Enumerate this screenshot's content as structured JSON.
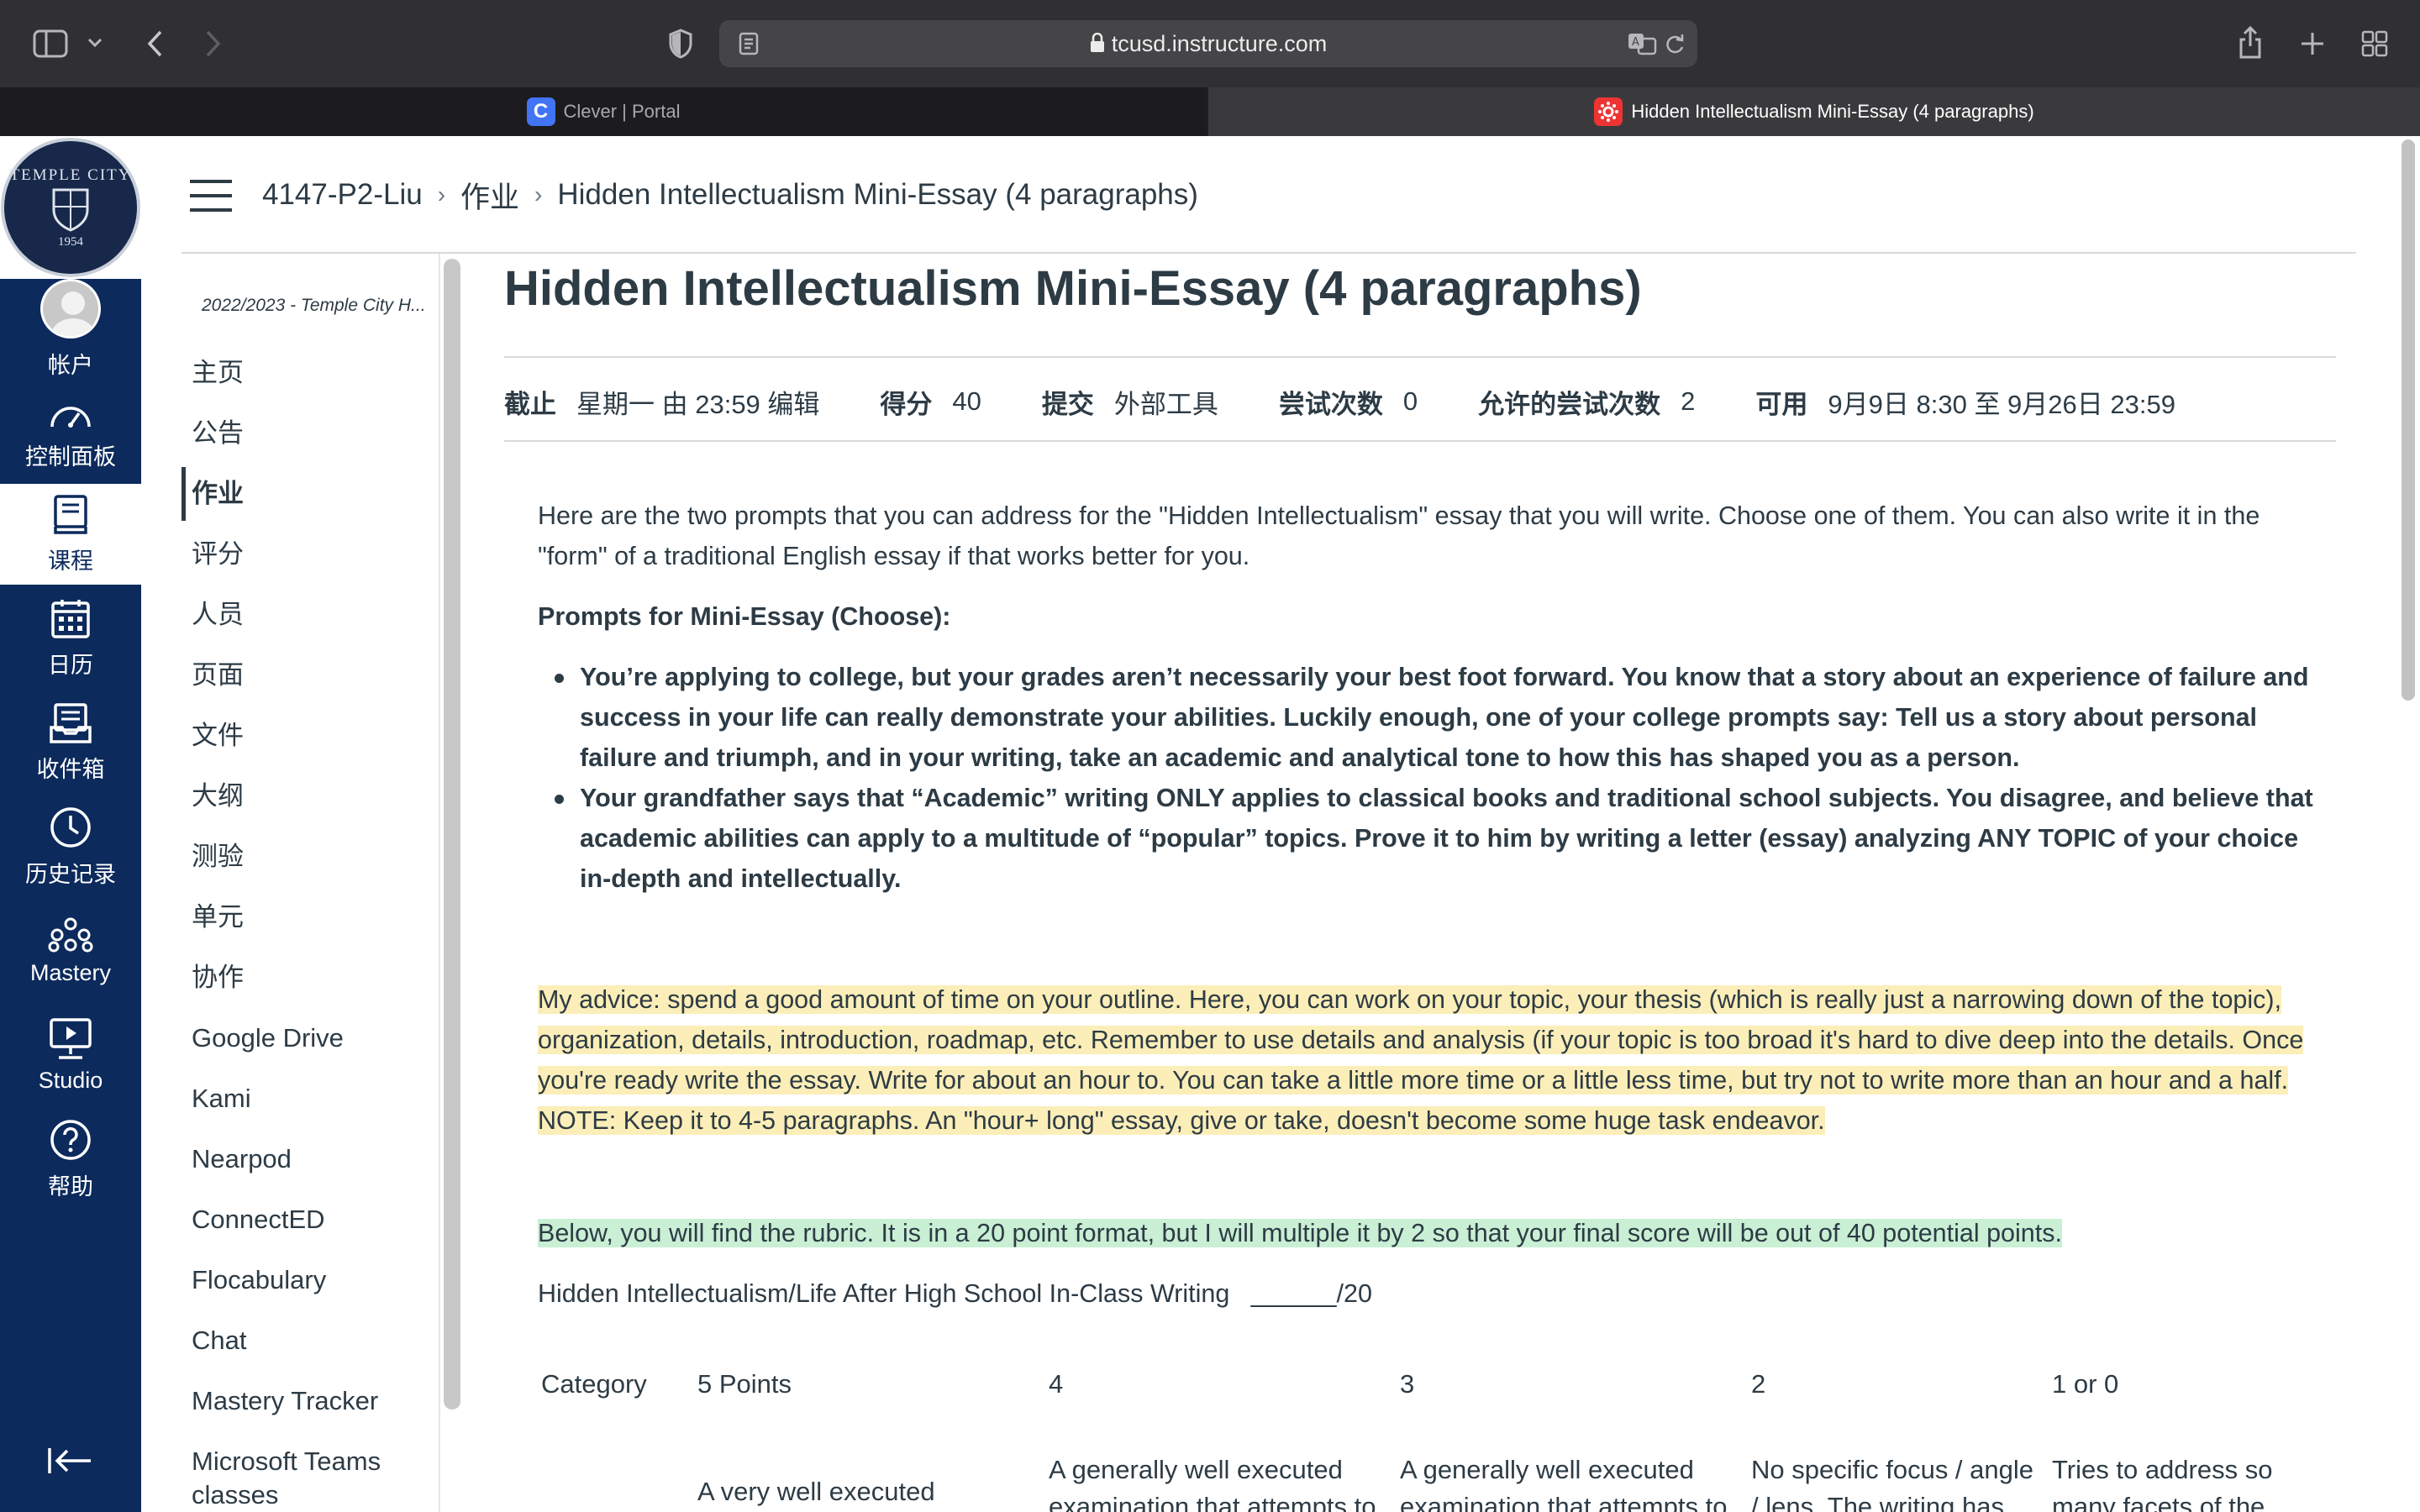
{
  "browser": {
    "url": "tcusd.instructure.com",
    "tabs": [
      {
        "label": "Clever | Portal",
        "icon": "C"
      },
      {
        "label": "Hidden Intellectualism Mini-Essay (4 paragraphs)"
      }
    ]
  },
  "global_nav": {
    "logo": {
      "text": "TEMPLE CITY",
      "year": "1954"
    },
    "items": [
      {
        "label": "帐户",
        "icon": "account-icon"
      },
      {
        "label": "控制面板",
        "icon": "dashboard-icon"
      },
      {
        "label": "课程",
        "icon": "courses-icon"
      },
      {
        "label": "日历",
        "icon": "calendar-icon"
      },
      {
        "label": "收件箱",
        "icon": "inbox-icon"
      },
      {
        "label": "历史记录",
        "icon": "history-icon"
      },
      {
        "label": "Mastery",
        "icon": "mastery-icon"
      },
      {
        "label": "Studio",
        "icon": "studio-icon"
      },
      {
        "label": "帮助",
        "icon": "help-icon"
      }
    ]
  },
  "breadcrumb": {
    "course": "4147-P2-Liu",
    "section": "作业",
    "page": "Hidden Intellectualism Mini-Essay (4 paragraphs)"
  },
  "course_nav": {
    "term": "2022/2023 - Temple City H...",
    "items": [
      "主页",
      "公告",
      "作业",
      "评分",
      "人员",
      "页面",
      "文件",
      "大纲",
      "测验",
      "单元",
      "协作",
      "Google Drive",
      "Kami",
      "Nearpod",
      "ConnectED",
      "Flocabulary",
      "Chat",
      "Mastery Tracker",
      "Microsoft Teams classes"
    ],
    "active": "作业"
  },
  "assignment": {
    "title": "Hidden Intellectualism Mini-Essay (4 paragraphs)",
    "details": {
      "due_label": "截止",
      "due_value": "星期一 由 23:59 编辑",
      "points_label": "得分",
      "points_value": "40",
      "submit_label": "提交",
      "submit_value": "外部工具",
      "attempts_label": "尝试次数",
      "attempts_value": "0",
      "allowed_label": "允许的尝试次数",
      "allowed_value": "2",
      "available_label": "可用",
      "available_value": "9月9日 8:30 至 9月26日 23:59"
    },
    "intro": "Here are the two prompts that you can address for the \"Hidden Intellectualism\" essay that you will write. Choose one of them. You can also write it in the \"form\" of a traditional English essay if that works better for you.",
    "prompts_heading": "Prompts for Mini-Essay (Choose):",
    "prompts": [
      "You’re applying to college, but your grades aren’t necessarily your best foot forward. You know that a story about an experience of failure and success in your life can really demonstrate your abilities. Luckily enough, one of your college prompts say: Tell us a story about personal failure and triumph, and in your writing, take an academic and analytical tone to how this has shaped you as a person.",
      "Your grandfather says that “Academic” writing ONLY applies to classical books and traditional school subjects. You disagree, and believe that academic abilities can apply to a multitude of “popular” topics. Prove it to him by writing a letter (essay) analyzing ANY TOPIC of your choice in-depth and intellectually."
    ],
    "advice": "My advice: spend a good amount of time on your outline. Here, you can work on your topic, your thesis (which is really just a narrowing down of the topic), organization, details, introduction, roadmap, etc. Remember to use details and analysis (if your topic is too broad it's hard to dive deep into the details. Once you're ready write the essay. Write for about an hour to. You can take a little more time or a little less time, but try not to write more than an hour and a half.  NOTE: Keep it to 4-5 paragraphs. An \"hour+ long\" essay, give or take, doesn't become some huge task endeavor.",
    "rubric_note": "Below, you will find the rubric. It is in a 20 point format, but I will multiple it by 2 so that your final score will be out of 40 potential points.",
    "rubric_title": "Hidden Intellectualism/Life After High School In-Class Writing   ______/20",
    "rubric": {
      "headers": [
        "Category",
        "5 Points",
        "4",
        "3",
        "2",
        "1 or 0"
      ],
      "row1": [
        "",
        "A very well executed",
        "A generally well executed examination that attempts to",
        "A generally well executed examination that attempts to",
        "No specific focus / angle / lens. The writing has",
        "Tries to address so many facets of the"
      ]
    }
  },
  "colors": {
    "global_nav": "#0c2a5c",
    "highlight_yellow": "#fbeeb8",
    "highlight_green": "#c9efd4",
    "text": "#2d3b45"
  }
}
